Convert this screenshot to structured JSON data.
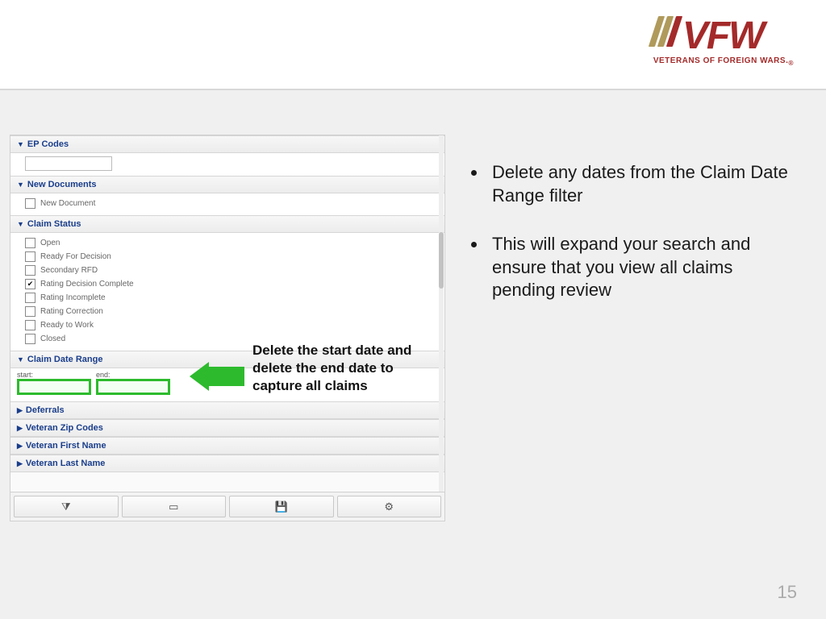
{
  "logo": {
    "main": "VFW",
    "subtitle": "VETERANS OF FOREIGN WARS.",
    "sub_suffix": "®"
  },
  "panel": {
    "sections": {
      "ep_codes": {
        "title": "EP Codes"
      },
      "new_docs": {
        "title": "New Documents",
        "item": "New Document"
      },
      "claim_status": {
        "title": "Claim Status",
        "items": [
          {
            "label": "Open",
            "checked": false
          },
          {
            "label": "Ready For Decision",
            "checked": false
          },
          {
            "label": "Secondary RFD",
            "checked": false
          },
          {
            "label": "Rating Decision Complete",
            "checked": true
          },
          {
            "label": "Rating Incomplete",
            "checked": false
          },
          {
            "label": "Rating Correction",
            "checked": false
          },
          {
            "label": "Ready to Work",
            "checked": false
          },
          {
            "label": "Closed",
            "checked": false
          }
        ]
      },
      "claim_date_range": {
        "title": "Claim Date Range",
        "start_label": "start:",
        "end_label": "end:"
      },
      "deferrals": {
        "title": "Deferrals"
      },
      "vet_zip": {
        "title": "Veteran Zip Codes"
      },
      "vet_first": {
        "title": "Veteran First Name"
      },
      "vet_last": {
        "title": "Veteran Last Name"
      }
    },
    "callout": "Delete the start date and delete the end date to capture all claims"
  },
  "bullets": [
    "Delete any dates from the Claim Date Range filter",
    "This will expand your search and ensure that you view all claims pending review"
  ],
  "page_number": "15"
}
